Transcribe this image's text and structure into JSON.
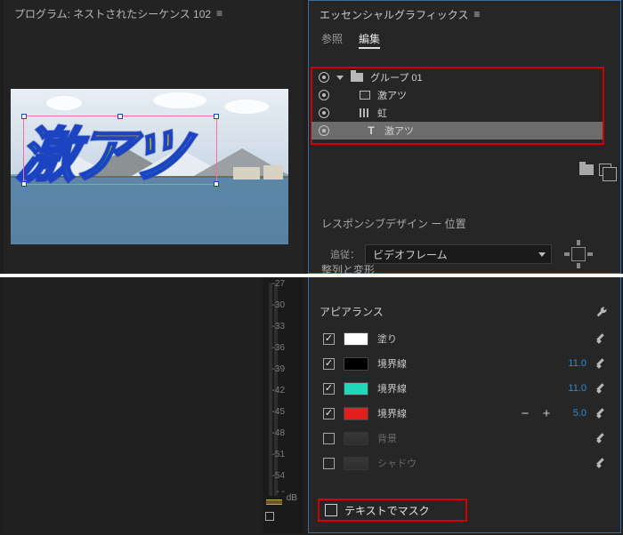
{
  "program": {
    "title": "プログラム:  ネストされたシーケンス 102"
  },
  "preview": {
    "text": "激アツ"
  },
  "eg": {
    "title": "エッセンシャルグラフィックス",
    "tab_browse": "参照",
    "tab_edit": "編集"
  },
  "layers": {
    "group": "グループ 01",
    "clip1": "激アツ",
    "clip2": "虹",
    "text": "激アツ"
  },
  "responsive": {
    "header": "レスポンシブデザイン ー 位置",
    "follow_label": "追従：",
    "follow_value": "ビデオフレーム"
  },
  "align_header": "整列と変形",
  "audio": {
    "ticks": [
      "-27",
      "-30",
      "-33",
      "-36",
      "-39",
      "-42",
      "-45",
      "-48",
      "-51",
      "-54",
      "- -"
    ],
    "unit": "dB"
  },
  "appearance": {
    "header": "アピアランス",
    "fill": "塗り",
    "stroke1": {
      "label": "境界線",
      "value": "11.0"
    },
    "stroke2": {
      "label": "境界線",
      "value": "11.0"
    },
    "stroke3": {
      "label": "境界線",
      "value": "5.0"
    },
    "bg": "背景",
    "shadow": "シャドウ",
    "mask": "テキストでマスク"
  },
  "colors": {
    "fill": "#ffffff",
    "stroke1": "#000000",
    "stroke2": "#1fd8b8",
    "stroke3": "#e21e1e"
  }
}
